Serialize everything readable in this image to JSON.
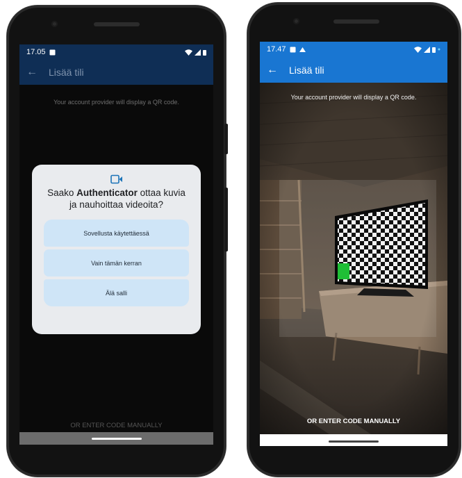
{
  "phone_left": {
    "status": {
      "time": "17.05"
    },
    "appbar": {
      "title": "Lisää tili",
      "back": "←"
    },
    "instruction": "Your account provider will display a QR code.",
    "dialog": {
      "question_prefix": "Saako ",
      "question_app": "Authenticator",
      "question_suffix": " ottaa kuvia ja nauhoittaa videoita?",
      "options": [
        "Sovellusta käytettäessä",
        "Vain tämän kerran",
        "Älä salli"
      ]
    },
    "manual_code": "OR ENTER CODE MANUALLY",
    "colors": {
      "screen_bg": "#0a0a0a",
      "appbar": "#0f2e55",
      "dialog_bg": "#e9ebee",
      "option_bg": "#cfe5f7"
    }
  },
  "phone_right": {
    "status": {
      "time": "17.47"
    },
    "appbar": {
      "title": "Lisää tili",
      "back": "←"
    },
    "instruction": "Your account provider will display a QR code.",
    "manual_code": "OR ENTER CODE MANUALLY",
    "colors": {
      "appbar": "#1976d2",
      "screen_marker": "#1fbf36"
    }
  },
  "icons": [
    "image-icon",
    "wifi-icon",
    "signal-icon",
    "battery-icon",
    "back-arrow-icon",
    "videocam-icon"
  ]
}
